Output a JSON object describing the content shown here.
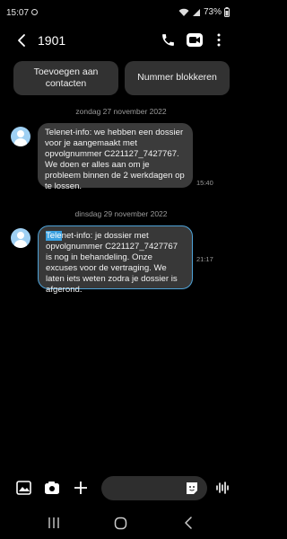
{
  "status_bar": {
    "time": "15:07",
    "battery": "73%"
  },
  "header": {
    "title": "1901"
  },
  "actions": {
    "add_contact": "Toevoegen aan\ncontacten",
    "block_number": "Nummer blokkeren"
  },
  "messages": [
    {
      "date": "zondag 27 november 2022",
      "text": "Telenet-info: we hebben een dossier voor je aangemaakt met opvolgnummer C221127_7427767. We doen er alles aan om je probleem binnen de 2 werkdagen op te lossen.",
      "time": "15:40"
    },
    {
      "date": "dinsdag 29 november 2022",
      "text_highlight": "Tele",
      "text_rest": "net-info: je dossier met opvolgnummer C221127_7427767 is nog in behandeling. Onze excuses voor de vertraging. We laten iets weten zodra je dossier is afgerond.",
      "time": "21:17"
    }
  ],
  "compose": {
    "placeholder": ""
  },
  "colors": {
    "bubble": "#3b3b3b",
    "accent": "#3aa0e0",
    "avatar": "#9fd0f3"
  }
}
